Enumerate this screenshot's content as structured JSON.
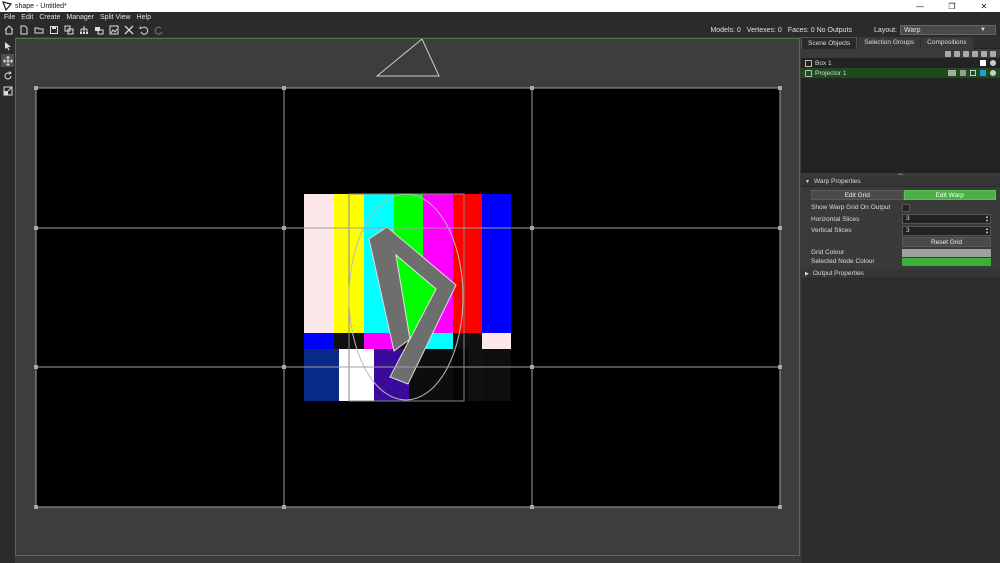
{
  "window": {
    "title": "shape - Untitled*",
    "minimize": "—",
    "maximize": "❐",
    "close": "✕"
  },
  "menu": [
    "File",
    "Edit",
    "Create",
    "Manager",
    "Split View",
    "Help"
  ],
  "toolbar": {
    "icons": [
      "home-icon",
      "new-file-icon",
      "open-folder-icon",
      "save-icon",
      "save-as-icon",
      "hierarchy-icon",
      "layers-icon",
      "media-icon",
      "tools-icon",
      "undo-icon",
      "redo-icon"
    ]
  },
  "stats": {
    "models": "Models: 0",
    "vertexes": "Vertexes: 0",
    "faces": "Faces: 0 No Outputs"
  },
  "layout": {
    "label": "Layout:",
    "value": "Warp"
  },
  "right_panel": {
    "tabs": [
      "Scene Objects",
      "Selection Groups",
      "Compositions"
    ],
    "objects": [
      {
        "name": "Box 1",
        "selected": false
      },
      {
        "name": "Projector 1",
        "selected": true
      }
    ],
    "warp_properties": {
      "header": "Warp Properties",
      "edit_grid": "Edit Grid",
      "edit_warp": "Edit Warp",
      "show_grid_label": "Show Warp Grid On Output",
      "horizontal_label": "Horizontal Slices",
      "horizontal_value": "3",
      "vertical_label": "Vertical Slices",
      "vertical_value": "3",
      "reset_grid": "Reset Grid",
      "grid_colour_label": "Grid Colour",
      "node_colour_label": "Selected Node Colour",
      "grid_colour": "#a0a0a0",
      "node_colour": "#3cb034"
    },
    "output_properties": {
      "header": "Output Properties"
    }
  },
  "colors": {
    "accent_green": "#4caf45",
    "viewport_border": "#3f7a3f",
    "selection": "#1e4a1e"
  }
}
